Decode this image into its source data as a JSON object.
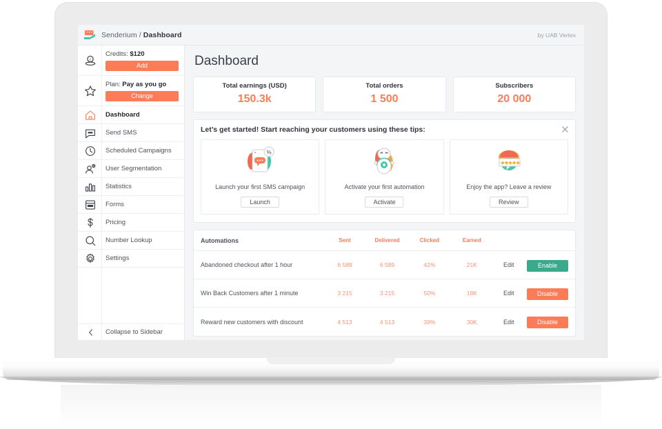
{
  "topbar": {
    "logo_icon": "senderium-logo-icon",
    "brand": "Senderium",
    "separator": "/",
    "section": "Dashboard",
    "byline": "by UAB Vertex"
  },
  "sidebar": {
    "credits": {
      "label": "Credits:",
      "value": "$120",
      "icon": "coin-icon",
      "button": "Add"
    },
    "plan": {
      "label": "Plan:",
      "value": "Pay as you go",
      "icon": "star-icon",
      "button": "Change"
    },
    "nav": [
      {
        "label": "Dashboard",
        "icon": "home-icon",
        "active": true
      },
      {
        "label": "Send SMS",
        "icon": "chat-bubble-icon",
        "active": false
      },
      {
        "label": "Scheduled Campaigns",
        "icon": "clock-icon",
        "active": false
      },
      {
        "label": "User Segmentation",
        "icon": "user-add-icon",
        "active": false
      },
      {
        "label": "Statistics",
        "icon": "bar-chart-icon",
        "active": false
      },
      {
        "label": "Forms",
        "icon": "form-icon",
        "active": false
      },
      {
        "label": "Pricing",
        "icon": "dollar-icon",
        "active": false
      },
      {
        "label": "Number Lookup",
        "icon": "search-icon",
        "active": false
      },
      {
        "label": "Settings",
        "icon": "gear-icon",
        "active": false
      }
    ],
    "collapse": {
      "label": "Collapse to Sidebar",
      "icon": "chevron-left-icon"
    }
  },
  "main": {
    "page_title": "Dashboard",
    "stats": [
      {
        "title": "Total earnings (USD)",
        "value": "150.3k"
      },
      {
        "title": "Total orders",
        "value": "1 500"
      },
      {
        "title": "Subscribers",
        "value": "20 000"
      }
    ],
    "tips": {
      "heading": "Let’s get started! Start reaching your customers using these tips:",
      "close_icon": "close-icon",
      "items": [
        {
          "caption": "Launch your first SMS campaign",
          "button": "Launch",
          "icon": "phone-sms-icon"
        },
        {
          "caption": "Activate your first automation",
          "button": "Activate",
          "icon": "robot-gear-icon"
        },
        {
          "caption": "Enjoy the app? Leave a review",
          "button": "Review",
          "icon": "review-stars-icon"
        }
      ]
    },
    "automations": {
      "title": "Automations",
      "columns": [
        "Sent",
        "Delivered",
        "Clicked",
        "Earned"
      ],
      "edit_label": "Edit",
      "rows": [
        {
          "name": "Abandoned checkout after 1 hour",
          "sent": "6 589",
          "delivered": "6 589",
          "clicked": "42%",
          "earned": "21K",
          "action": "Enable",
          "state": "enable"
        },
        {
          "name": "Win Back Customers after 1 minute",
          "sent": "3 215",
          "delivered": "3 215",
          "clicked": "50%",
          "earned": "18K",
          "action": "Disable",
          "state": "disable"
        },
        {
          "name": "Reward new customers with discount",
          "sent": "4 513",
          "delivered": "4 513",
          "clicked": "39%",
          "earned": "30K",
          "action": "Disable",
          "state": "disable"
        }
      ]
    }
  },
  "colors": {
    "accent_orange": "#fb7c56",
    "accent_green": "#3aa98c",
    "text_dark": "#2f343b",
    "text_muted": "#4d525a",
    "app_bg": "#f4f5f7"
  }
}
